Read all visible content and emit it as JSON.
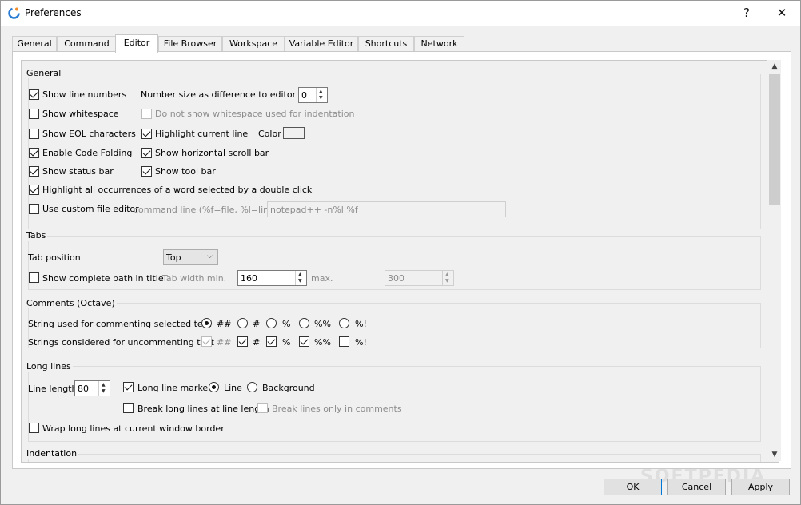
{
  "window": {
    "title": "Preferences",
    "help_label": "?",
    "close_label": "✕"
  },
  "tabs": [
    {
      "label": "General"
    },
    {
      "label": "Command"
    },
    {
      "label": "Editor",
      "active": true
    },
    {
      "label": "File Browser"
    },
    {
      "label": "Workspace"
    },
    {
      "label": "Variable Editor"
    },
    {
      "label": "Shortcuts"
    },
    {
      "label": "Network"
    }
  ],
  "general": {
    "title": "General",
    "show_line_numbers": {
      "label": "Show line numbers",
      "checked": true
    },
    "number_size_label": "Number size as difference to editor font",
    "number_size_value": "0",
    "show_whitespace": {
      "label": "Show whitespace",
      "checked": false
    },
    "no_whitespace_indent": {
      "label": "Do not show whitespace used for indentation",
      "checked": false,
      "disabled": true
    },
    "show_eol": {
      "label": "Show EOL characters",
      "checked": false
    },
    "highlight_line": {
      "label": "Highlight current line",
      "checked": true
    },
    "color_label": "Color",
    "code_folding": {
      "label": "Enable Code Folding",
      "checked": true
    },
    "horizontal_scroll": {
      "label": "Show horizontal scroll bar",
      "checked": true
    },
    "status_bar": {
      "label": "Show status bar",
      "checked": true
    },
    "tool_bar": {
      "label": "Show tool bar",
      "checked": true
    },
    "highlight_occurrences": {
      "label": "Highlight all occurrences of a word selected by a double click",
      "checked": true
    },
    "custom_editor": {
      "label": "Use custom file editor",
      "checked": false
    },
    "command_line_label": "command line (%f=file, %l=line):",
    "command_line_value": "notepad++ -n%l %f"
  },
  "tabs_group": {
    "title": "Tabs",
    "tab_position_label": "Tab position",
    "tab_position_value": "Top",
    "complete_path": {
      "label": "Show complete path in title",
      "checked": false
    },
    "width_min_label": "Tab width min.",
    "width_min_value": "160",
    "max_label": "max.",
    "max_value": "300"
  },
  "comments": {
    "title": "Comments (Octave)",
    "commenting_label": "String used for commenting selected text",
    "commenting_options": [
      {
        "label": "##",
        "checked": true
      },
      {
        "label": "#",
        "checked": false
      },
      {
        "label": "%",
        "checked": false
      },
      {
        "label": "%%",
        "checked": false
      },
      {
        "label": "%!",
        "checked": false
      }
    ],
    "uncommenting_label": "Strings considered for uncommenting text",
    "uncommenting_options": [
      {
        "label": "##",
        "checked": true,
        "disabled": true
      },
      {
        "label": "#",
        "checked": true
      },
      {
        "label": "%",
        "checked": true
      },
      {
        "label": "%%",
        "checked": true
      },
      {
        "label": "%!",
        "checked": false
      }
    ]
  },
  "long_lines": {
    "title": "Long lines",
    "line_length_label": "Line length",
    "line_length_value": "80",
    "marker": {
      "label": "Long line marker",
      "checked": true
    },
    "line_radio": {
      "label": "Line",
      "checked": true
    },
    "background_radio": {
      "label": "Background",
      "checked": false
    },
    "break_long": {
      "label": "Break long lines at line length",
      "checked": false
    },
    "break_comments": {
      "label": "Break lines only in comments",
      "checked": false,
      "disabled": true
    },
    "wrap_long": {
      "label": "Wrap long lines at current window border",
      "checked": false
    }
  },
  "indentation": {
    "title": "Indentation"
  },
  "buttons": {
    "ok": "OK",
    "cancel": "Cancel",
    "apply": "Apply"
  },
  "watermark": "SOFTPEDIA"
}
